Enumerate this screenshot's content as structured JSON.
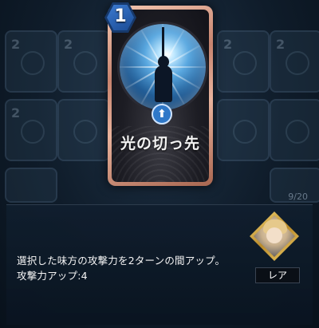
{
  "card": {
    "cost": "1",
    "name": "光の切っ先",
    "art_icon": "sword-light-figure",
    "badge_icon": "up-arrow-icon"
  },
  "description": {
    "line1": "選択した味方の攻撃力を2ターンの間アップ。",
    "line2": "攻撃力アップ:4"
  },
  "character": {
    "rarity": "レア"
  },
  "background": {
    "counter": "9/20",
    "card_costs": [
      "2",
      "2",
      "2",
      "2",
      "2"
    ]
  },
  "colors": {
    "cost_blue": "#2f6dc4",
    "card_frame": "#d9a08a",
    "panel_bg": "#0f1c2a"
  }
}
